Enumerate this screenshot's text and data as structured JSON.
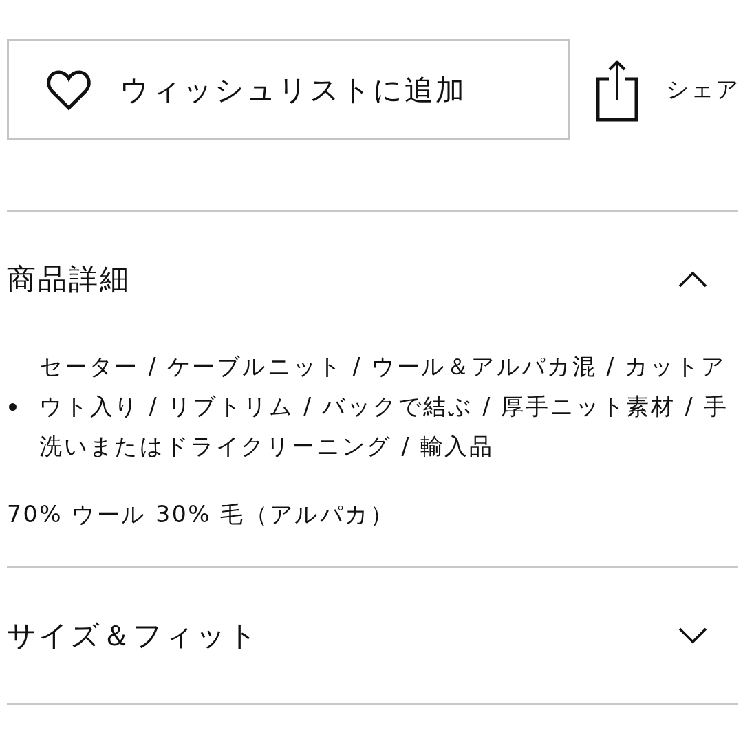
{
  "actions": {
    "wishlist": {
      "label": "ウィッシュリストに追加"
    },
    "share": {
      "label": "シェア"
    }
  },
  "sections": [
    {
      "title": "商品詳細",
      "expanded": true,
      "bullets": [
        "セーター / ケーブルニット / ウール＆アルパカ混 / カットアウト入り / リブトリム / バックで結ぶ / 厚手ニット素材 / 手洗いまたはドライクリーニング / 輸入品"
      ],
      "paragraphs": [
        "70% ウール 30% 毛（アルパカ）"
      ]
    },
    {
      "title": "サイズ＆フィット",
      "expanded": false
    }
  ]
}
